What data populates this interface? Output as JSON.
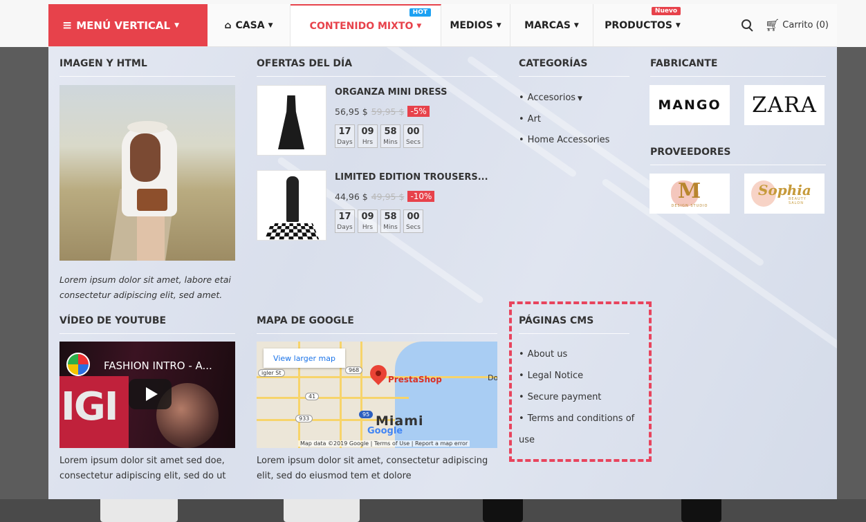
{
  "nav": {
    "vertical_menu": "MENÚ VERTICAL",
    "items": [
      {
        "label": "CASA"
      },
      {
        "label": "CONTENIDO MIXTO",
        "badge": "HOT"
      },
      {
        "label": "MEDIOS"
      },
      {
        "label": "MARCAS"
      },
      {
        "label": "PRODUCTOS",
        "badge": "Nuevo"
      }
    ],
    "cart": "Carrito (0)"
  },
  "image_html": {
    "title": "IMAGEN Y HTML",
    "caption": "Lorem ipsum dolor sit amet, labore etai consectetur adipiscing elit, sed amet."
  },
  "deals": {
    "title": "OFERTAS DEL DÍA",
    "products": [
      {
        "name": "ORGANZA MINI DRESS",
        "price": "56,95 $",
        "old_price": "59,95 $",
        "discount": "-5%",
        "countdown": [
          {
            "num": "17",
            "lbl": "Days"
          },
          {
            "num": "09",
            "lbl": "Hrs"
          },
          {
            "num": "58",
            "lbl": "Mins"
          },
          {
            "num": "00",
            "lbl": "Secs"
          }
        ]
      },
      {
        "name": "LIMITED EDITION TROUSERS...",
        "price": "44,96 $",
        "old_price": "49,95 $",
        "discount": "-10%",
        "countdown": [
          {
            "num": "17",
            "lbl": "Days"
          },
          {
            "num": "09",
            "lbl": "Hrs"
          },
          {
            "num": "58",
            "lbl": "Mins"
          },
          {
            "num": "00",
            "lbl": "Secs"
          }
        ]
      }
    ]
  },
  "categories": {
    "title": "CATEGORÍAS",
    "items": [
      "Accesorios",
      "Art",
      "Home Accessories"
    ]
  },
  "manufacturer": {
    "title": "FABRICANTE",
    "logos": [
      "MANGO",
      "ZARA"
    ]
  },
  "suppliers": {
    "title": "PROVEEDORES",
    "logos": [
      {
        "mark": "M",
        "sub": "DESIGN STUDIO"
      },
      {
        "mark": "Sophia",
        "sub": "BEAUTY SALON"
      }
    ]
  },
  "youtube": {
    "title": "VÍDEO DE YOUTUBE",
    "video_title": "FASHION INTRO - A...",
    "video_letters": "IGI",
    "caption": "Lorem ipsum dolor sit amet sed doe, consectetur adipiscing elit, sed do ut"
  },
  "google_map": {
    "title": "MAPA DE GOOGLE",
    "larger_map": "View larger map",
    "store": "PrestaShop",
    "city": "Miami",
    "brand": "Google",
    "attribution": "Map data ©2019 Google | Terms of Use | Report a map error",
    "shields": [
      "968",
      "41",
      "933",
      "95"
    ],
    "street": "igler St",
    "dock": "Do",
    "caption": "Lorem ipsum dolor sit amet, consectetur adipiscing elit, sed do eiusmod tem et dolore"
  },
  "cms": {
    "title": "PÁGINAS CMS",
    "items": [
      "About us",
      "Legal Notice",
      "Secure payment",
      "Terms and conditions of use"
    ]
  },
  "colors": {
    "accent": "#e7424b",
    "hot_badge": "#1da1f2",
    "highlight_dashed": "#e8445d"
  }
}
